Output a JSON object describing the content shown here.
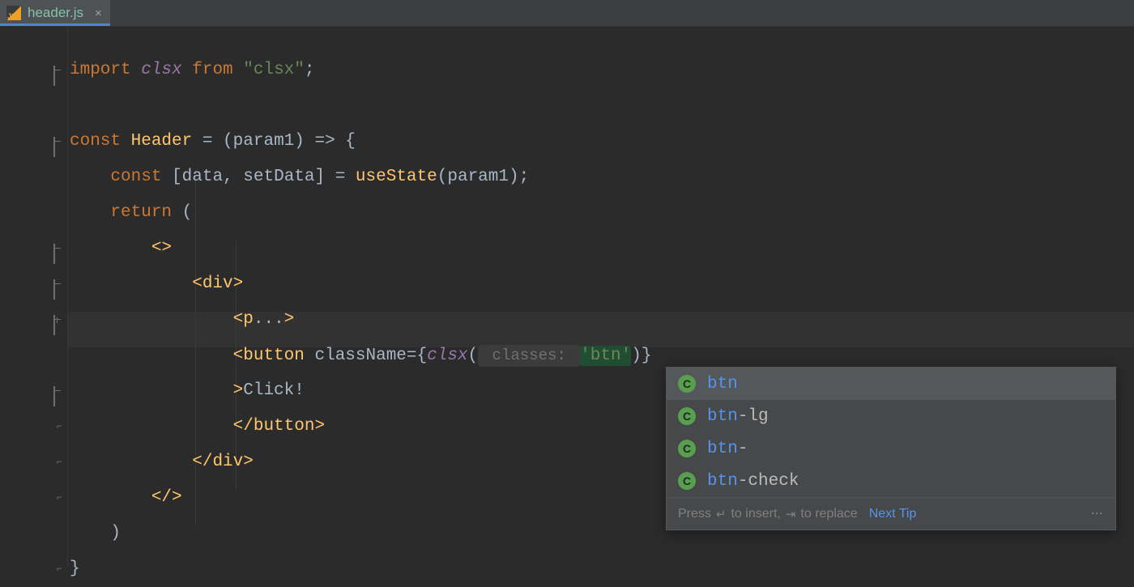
{
  "tab": {
    "filename": "header.js",
    "icon_label": "JS"
  },
  "code": {
    "lines": [
      {
        "t": [
          "import ",
          "clsx",
          " from ",
          "\"clsx\"",
          ";"
        ]
      },
      {
        "t": [
          ""
        ]
      },
      {
        "t": [
          "const ",
          "Header",
          " = (",
          "param1",
          ") => {"
        ]
      },
      {
        "t": [
          "    const ",
          "[",
          "data",
          ", ",
          "setData",
          "] = ",
          "useState",
          "(",
          "param1",
          ");"
        ]
      },
      {
        "t": [
          "    ",
          "return",
          " ("
        ]
      },
      {
        "t": [
          "        <>"
        ]
      },
      {
        "t": [
          "            <",
          "div",
          ">"
        ]
      },
      {
        "t": [
          "                <",
          "p",
          "...",
          ">"
        ]
      },
      {
        "t": [
          "                <",
          "button",
          " ",
          "className",
          "=",
          "{",
          "clsx",
          "(",
          " classes: ",
          "'btn'",
          ")",
          "}"
        ]
      },
      {
        "t": [
          "                >",
          "Click!"
        ]
      },
      {
        "t": [
          "                </",
          "button",
          ">"
        ]
      },
      {
        "t": [
          "            </",
          "div",
          ">"
        ]
      },
      {
        "t": [
          "        </>"
        ]
      },
      {
        "t": [
          "    )"
        ]
      },
      {
        "t": [
          "}"
        ]
      }
    ]
  },
  "completions": {
    "badge_letter": "C",
    "items": [
      {
        "match": "btn",
        "rest": ""
      },
      {
        "match": "btn",
        "rest": "-lg"
      },
      {
        "match": "btn",
        "rest": "-"
      },
      {
        "match": "btn",
        "rest": "-check"
      }
    ],
    "footer": {
      "text_prefix": "Press",
      "enter_glyph": "↵",
      "text_mid1": "to insert,",
      "tab_glyph": "⇥",
      "text_mid2": "to replace",
      "link": "Next Tip"
    }
  }
}
